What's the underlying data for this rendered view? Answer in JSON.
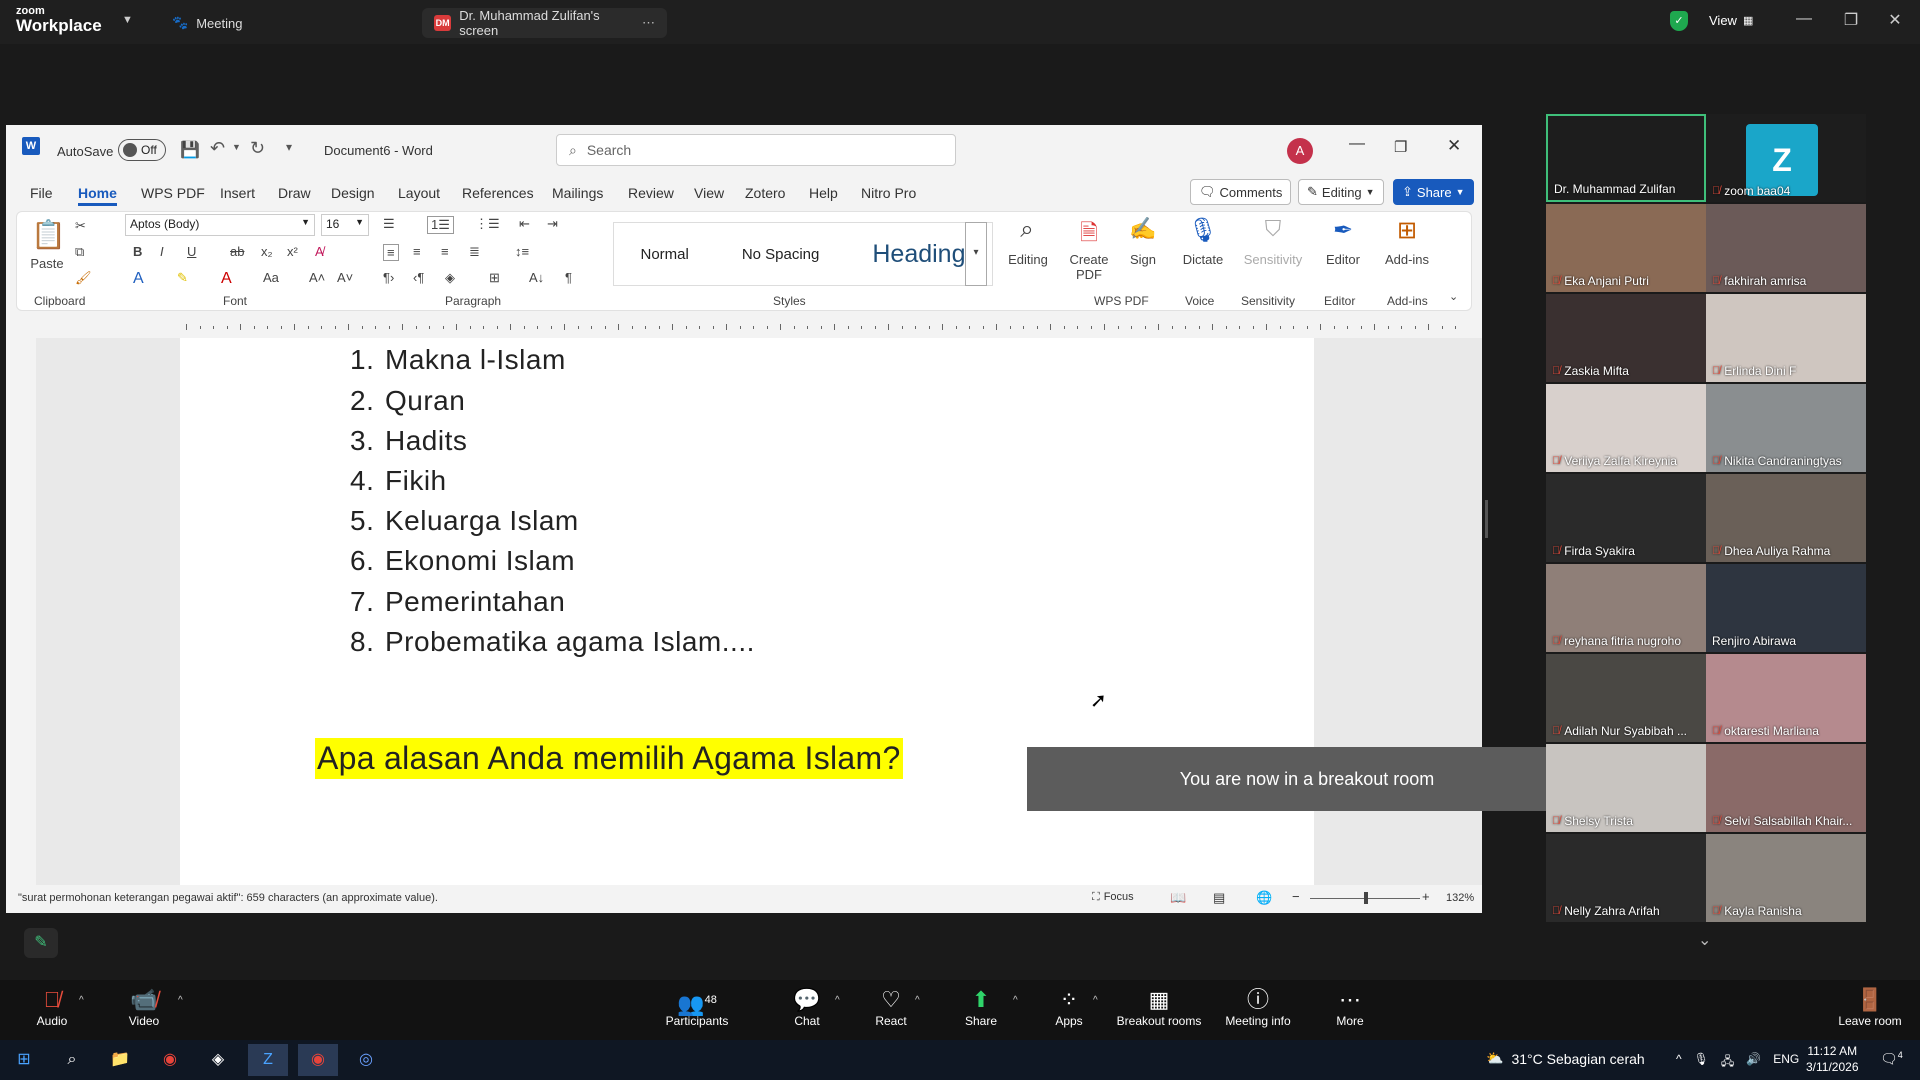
{
  "zoom": {
    "brand_top": "zoom",
    "brand_bottom": "Workplace",
    "meeting_tab": "Meeting",
    "share_tab_badge": "DM",
    "share_tab": "Dr. Muhammad Zulifan's screen",
    "view_label": "View"
  },
  "word": {
    "autosave_label": "AutoSave",
    "autosave_state": "Off",
    "doc_title": "Document6  -  Word",
    "search_placeholder": "Search",
    "avatar_initial": "A",
    "menus": [
      "File",
      "Home",
      "WPS PDF",
      "Insert",
      "Draw",
      "Design",
      "Layout",
      "References",
      "Mailings",
      "Review",
      "View",
      "Zotero",
      "Help",
      "Nitro Pro"
    ],
    "comments_label": "Comments",
    "editing_label": "Editing",
    "share_label": "Share",
    "ribbon": {
      "paste": "Paste",
      "font_name": "Aptos (Body)",
      "font_size": "16",
      "styles": [
        "Normal",
        "No Spacing",
        "Heading"
      ],
      "editing": "Editing",
      "create_pdf": "Create PDF",
      "sign": "Sign",
      "dictate": "Dictate",
      "sensitivity": "Sensitivity",
      "editor": "Editor",
      "addins": "Add-ins",
      "groups": {
        "clipboard": "Clipboard",
        "font": "Font",
        "paragraph": "Paragraph",
        "styles": "Styles",
        "wps_pdf": "WPS PDF",
        "voice": "Voice",
        "sensitivity": "Sensitivity",
        "editor": "Editor",
        "addins": "Add-ins"
      }
    },
    "list": [
      {
        "num": "1.",
        "text": "Makna l-Islam"
      },
      {
        "num": "2.",
        "text": "Quran"
      },
      {
        "num": "3.",
        "text": "Hadits"
      },
      {
        "num": "4.",
        "text": "Fikih"
      },
      {
        "num": "5.",
        "text": "Keluarga Islam"
      },
      {
        "num": "6.",
        "text": "Ekonomi Islam"
      },
      {
        "num": "7.",
        "text": "Pemerintahan"
      },
      {
        "num": "8.",
        "text": "Probematika agama Islam...."
      }
    ],
    "question": "Apa alasan Anda memilih Agama Islam?",
    "status_text": "\"surat permohonan keterangan pegawai aktif\": 659 characters (an approximate value).",
    "focus_label": "Focus",
    "zoom_level": "132%"
  },
  "toast": "You are now in a breakout room",
  "participants": [
    {
      "name": "Dr. Muhammad Zulifan",
      "muted": false,
      "color": "#1d1d1d"
    },
    {
      "name": "zoom baa04",
      "muted": true,
      "color": "#1d1d1d",
      "initial": "Z"
    },
    {
      "name": "Eka Anjani Putri",
      "muted": true,
      "color": "#8a6a55"
    },
    {
      "name": "fakhirah amrisa",
      "muted": true,
      "color": "#6b5a58"
    },
    {
      "name": "Zaskia Mifta",
      "muted": true,
      "color": "#3a3030"
    },
    {
      "name": "Erlinda Dini F",
      "muted": true,
      "color": "#cfc6c0"
    },
    {
      "name": "Veriiya Zalfa Kireynia",
      "muted": true,
      "color": "#d8d0cc"
    },
    {
      "name": "Nikita Candraningtyas",
      "muted": true,
      "color": "#8a8e90"
    },
    {
      "name": "Firda Syakira",
      "muted": true,
      "color": "#2a2a2a"
    },
    {
      "name": "Dhea Auliya Rahma",
      "muted": true,
      "color": "#6a6058"
    },
    {
      "name": "reyhana fitria nugroho",
      "muted": true,
      "color": "#8f7f78"
    },
    {
      "name": "Renjiro Abirawa",
      "muted": false,
      "color": "#2e3540"
    },
    {
      "name": "Adilah Nur Syabibah ...",
      "muted": true,
      "color": "#4a4844"
    },
    {
      "name": "oktaresti Marliana",
      "muted": true,
      "color": "#b58a8e"
    },
    {
      "name": "Shelsy Trista",
      "muted": true,
      "color": "#c8c4c0"
    },
    {
      "name": "Selvi Salsabillah Khair...",
      "muted": true,
      "color": "#8a6a68"
    },
    {
      "name": "Nelly Zahra Arifah",
      "muted": true,
      "color": "#2a2a2a"
    },
    {
      "name": "Kayla Ranisha",
      "muted": true,
      "color": "#8a847e"
    }
  ],
  "toolbar": {
    "audio": "Audio",
    "video": "Video",
    "participants": "Participants",
    "participants_count": "48",
    "chat": "Chat",
    "react": "React",
    "share": "Share",
    "apps": "Apps",
    "breakout": "Breakout rooms",
    "meeting_info": "Meeting info",
    "more": "More",
    "leave": "Leave room"
  },
  "taskbar": {
    "weather": "31°C  Sebagian cerah",
    "lang": "ENG",
    "time": "11:12 AM",
    "date": "3/11/2026",
    "notif_count": "4"
  }
}
